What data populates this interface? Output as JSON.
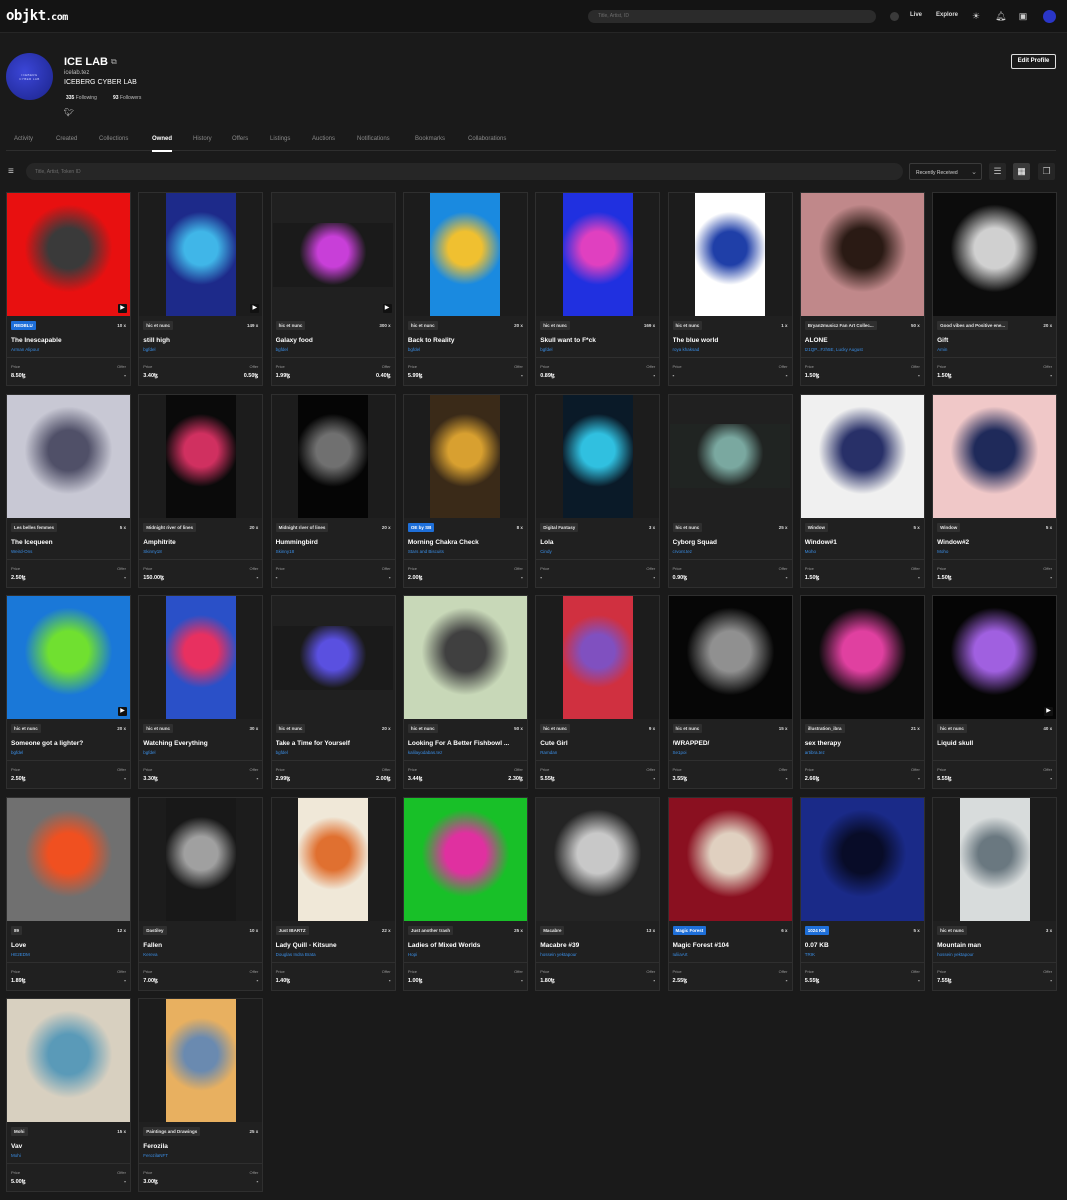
{
  "topbar": {
    "logo": "objkt",
    "logo_suffix": ".com",
    "search_placeholder": "Title, Artist, ID",
    "nav_live": "Live",
    "nav_explore": "Explore"
  },
  "profile": {
    "avatar_text_1": "ICEBERG",
    "avatar_text_2": "CYBER LAB",
    "name": "ICE LAB",
    "domain": "icelab.tez",
    "alias": "ICEBERG CYBER LAB",
    "following_count": "335",
    "following_label": "Following",
    "followers_count": "93",
    "followers_label": "Followers",
    "edit_button": "Edit Profile"
  },
  "tabs": [
    {
      "label": "Activity"
    },
    {
      "label": "Created"
    },
    {
      "label": "Collections"
    },
    {
      "label": "Owned"
    },
    {
      "label": "History"
    },
    {
      "label": "Offers"
    },
    {
      "label": "Listings"
    },
    {
      "label": "Auctions"
    },
    {
      "label": "Notifications"
    },
    {
      "label": "Bookmarks"
    },
    {
      "label": "Collaborations"
    }
  ],
  "active_tab": "Owned",
  "filters": {
    "search_placeholder": "Title, Artist, Token ID",
    "sort": "Recently Received"
  },
  "labels": {
    "price": "Price",
    "offer": "Offer"
  },
  "cards": [
    {
      "badge": "REDBLU",
      "badge_blue": true,
      "edition": "10 x",
      "title": "The Inescapable",
      "artist": "Arman Alipour",
      "price": "8.50ꜩ",
      "offer": "-",
      "video": true,
      "bg": "#e81010",
      "fg": "#3a3a3a"
    },
    {
      "badge": "hic et nunc",
      "edition": "149 x",
      "title": "still high",
      "artist": "bgfdel",
      "price": "3.40ꜩ",
      "offer": "0.50ꜩ",
      "video": true,
      "bg": "#1d2a8a",
      "fg": "#40b6e8",
      "portrait": true
    },
    {
      "badge": "hic et nunc",
      "edition": "300 x",
      "title": "Galaxy food",
      "artist": "bgfdel",
      "price": "1.99ꜩ",
      "offer": "0.40ꜩ",
      "video": true,
      "bg": "#1a1a1a",
      "fg": "#c83fd8",
      "wide": true
    },
    {
      "badge": "hic et nunc",
      "edition": "20 x",
      "title": "Back to Reality",
      "artist": "bgfdel",
      "price": "5.99ꜩ",
      "offer": "-",
      "bg": "#1a8ae0",
      "fg": "#f0c030",
      "portrait": true
    },
    {
      "badge": "hic et nunc",
      "edition": "169 x",
      "title": "Skull want to F*ck",
      "artist": "bgfdel",
      "price": "0.89ꜩ",
      "offer": "-",
      "bg": "#2030e0",
      "fg": "#e040c0",
      "portrait": true
    },
    {
      "badge": "hic et nunc",
      "edition": "1 x",
      "title": "The blue world",
      "artist": "roya khaksad",
      "price": "-",
      "offer": "-",
      "bg": "#ffffff",
      "fg": "#1f3fa8",
      "portrait": true
    },
    {
      "badge": "Bryan2musicz Fan Art Collec...",
      "edition": "50 x",
      "title": "ALONE",
      "artist": "tz1QP...Fzh5E, Lucky August",
      "price": "1.50ꜩ",
      "offer": "-",
      "bg": "#c0888a",
      "fg": "#2a1a14"
    },
    {
      "badge": "Good vibes and Positive ene...",
      "edition": "20 x",
      "title": "Gift",
      "artist": "Amin",
      "price": "1.50ꜩ",
      "offer": "-",
      "bg": "#0c0c0c",
      "fg": "#d0d0d0"
    },
    {
      "badge": "Les belles femmes",
      "edition": "5 x",
      "title": "The Icequeen",
      "artist": "Weird-Ons",
      "price": "2.50ꜩ",
      "offer": "-",
      "bg": "#c8c8d4",
      "fg": "#505068"
    },
    {
      "badge": "Midnight river of lines",
      "edition": "20 x",
      "title": "Amphitrite",
      "artist": "Skinny18",
      "price": "150.00ꜩ",
      "offer": "-",
      "bg": "#0a0a0a",
      "fg": "#d03060",
      "portrait": true
    },
    {
      "badge": "Midnight river of lines",
      "edition": "20 x",
      "title": "Hummingbird",
      "artist": "Skinny18",
      "price": "-",
      "offer": "-",
      "bg": "#050505",
      "fg": "#707070",
      "portrait": true
    },
    {
      "badge": "OE by SB",
      "badge_blue": true,
      "edition": "8 x",
      "title": "Morning Chakra Check",
      "artist": "Stars and Biscuits",
      "price": "2.00ꜩ",
      "offer": "-",
      "bg": "#3a2a18",
      "fg": "#d8a030",
      "portrait": true
    },
    {
      "badge": "Digital Fantasy",
      "edition": "3 x",
      "title": "Lola",
      "artist": "Cindy",
      "price": "-",
      "offer": "-",
      "bg": "#0a1a28",
      "fg": "#30c0e0",
      "portrait": true
    },
    {
      "badge": "hic et nunc",
      "edition": "25 x",
      "title": "Cyborg Squad",
      "artist": "crvont.tez",
      "price": "0.90ꜩ",
      "offer": "-",
      "bg": "#202422",
      "fg": "#7aa8a0",
      "wide": true
    },
    {
      "badge": "Window",
      "edition": "5 x",
      "title": "Window#1",
      "artist": "Moho",
      "price": "1.50ꜩ",
      "offer": "-",
      "bg": "#f0f0f0",
      "fg": "#283068"
    },
    {
      "badge": "Window",
      "edition": "5 x",
      "title": "Window#2",
      "artist": "Moho",
      "price": "1.50ꜩ",
      "offer": "-",
      "bg": "#f0c8c8",
      "fg": "#1f2a5a"
    },
    {
      "badge": "hic et nunc",
      "edition": "20 x",
      "title": "Someone got a lighter?",
      "artist": "bgfdel",
      "price": "2.50ꜩ",
      "offer": "-",
      "video": true,
      "bg": "#1a78d8",
      "fg": "#70e030"
    },
    {
      "badge": "hic et nunc",
      "edition": "30 x",
      "title": "Watching Everything",
      "artist": "bgfdel",
      "price": "3.30ꜩ",
      "offer": "-",
      "bg": "#2a50c8",
      "fg": "#e83060",
      "portrait": true
    },
    {
      "badge": "hic et nunc",
      "edition": "20 x",
      "title": "Take a Time for Yourself",
      "artist": "bgfdel",
      "price": "2.99ꜩ",
      "offer": "2.00ꜩ",
      "bg": "#1a1a1a",
      "fg": "#5a50e0",
      "wide": true
    },
    {
      "badge": "hic et nunc",
      "edition": "50 x",
      "title": "Looking For A Better Fishbowl ...",
      "artist": "kalilayodabas.tez",
      "price": "3.44ꜩ",
      "offer": "2.30ꜩ",
      "bg": "#c8d8b8",
      "fg": "#404040"
    },
    {
      "badge": "hic et nunc",
      "edition": "9 x",
      "title": "Cute Girl",
      "artist": "Ramdan",
      "price": "5.55ꜩ",
      "offer": "-",
      "bg": "#d03040",
      "fg": "#8050c0",
      "portrait": true
    },
    {
      "badge": "hic et nunc",
      "edition": "15 x",
      "title": "/WRAPPED/",
      "artist": "Se1poi",
      "price": "3.55ꜩ",
      "offer": "-",
      "bg": "#060606",
      "fg": "#909090"
    },
    {
      "badge": "illustration_ibra",
      "edition": "21 x",
      "title": "sex therapy",
      "artist": "artibra.tez",
      "price": "2.66ꜩ",
      "offer": "-",
      "bg": "#0a0a0a",
      "fg": "#e040a0"
    },
    {
      "badge": "hic et nunc",
      "edition": "40 x",
      "title": "Liquid skull",
      "artist": "",
      "price": "5.55ꜩ",
      "offer": "-",
      "video": true,
      "bg": "#050505",
      "fg": "#a060e0"
    },
    {
      "badge": "89",
      "edition": "12 x",
      "title": "Love",
      "artist": "HE2EDM",
      "price": "1.89ꜩ",
      "offer": "-",
      "bg": "#707070",
      "fg": "#f05020"
    },
    {
      "badge": "Dastiley",
      "edition": "10 x",
      "title": "Fallen",
      "artist": "Kereva",
      "price": "7.00ꜩ",
      "offer": "-",
      "bg": "#181818",
      "fg": "#a0a0a0",
      "portrait": true
    },
    {
      "badge": "Just IBARTZ",
      "edition": "22 x",
      "title": "Lady Quill - Kitsune",
      "artist": "Douglas Indra Brata",
      "price": "1.40ꜩ",
      "offer": "-",
      "bg": "#f0e8d8",
      "fg": "#e07030",
      "portrait": true
    },
    {
      "badge": "Just another trash",
      "edition": "25 x",
      "title": "Ladies of Mixed Worlds",
      "artist": "Hopi",
      "price": "1.00ꜩ",
      "offer": "-",
      "bg": "#18c028",
      "fg": "#e030a0"
    },
    {
      "badge": "Macabre",
      "edition": "13 x",
      "title": "Macabre #39",
      "artist": "hossein yektapour",
      "price": "1.80ꜩ",
      "offer": "-",
      "bg": "#242424",
      "fg": "#c8c8c8"
    },
    {
      "badge": "Magic Forest",
      "badge_blue": true,
      "edition": "6 x",
      "title": "Magic Forest #104",
      "artist": "IuliiaArt",
      "price": "2.55ꜩ",
      "offer": "-",
      "bg": "#8a1020",
      "fg": "#e0d0c0"
    },
    {
      "badge": "1024 KB",
      "badge_blue": true,
      "edition": "5 x",
      "title": "0.07 KB",
      "artist": "TRIK",
      "price": "5.55ꜩ",
      "offer": "-",
      "bg": "#1a2a88",
      "fg": "#080c28"
    },
    {
      "badge": "hic et nunc",
      "edition": "3 x",
      "title": "Mountain man",
      "artist": "hossein yektapour",
      "price": "7.55ꜩ",
      "offer": "-",
      "bg": "#d8dcdc",
      "fg": "#6a7880",
      "portrait": true
    },
    {
      "badge": "Mohi",
      "edition": "15 x",
      "title": "Vav",
      "artist": "Mohi",
      "price": "5.00ꜩ",
      "offer": "-",
      "bg": "#d8d0c0",
      "fg": "#5a9ab8"
    },
    {
      "badge": "Paintings and Drawings",
      "edition": "25 x",
      "title": "Ferozila",
      "artist": "FerozilaNFT",
      "price": "3.00ꜩ",
      "offer": "-",
      "bg": "#e8b060",
      "fg": "#6a8ab0",
      "portrait": true
    }
  ]
}
